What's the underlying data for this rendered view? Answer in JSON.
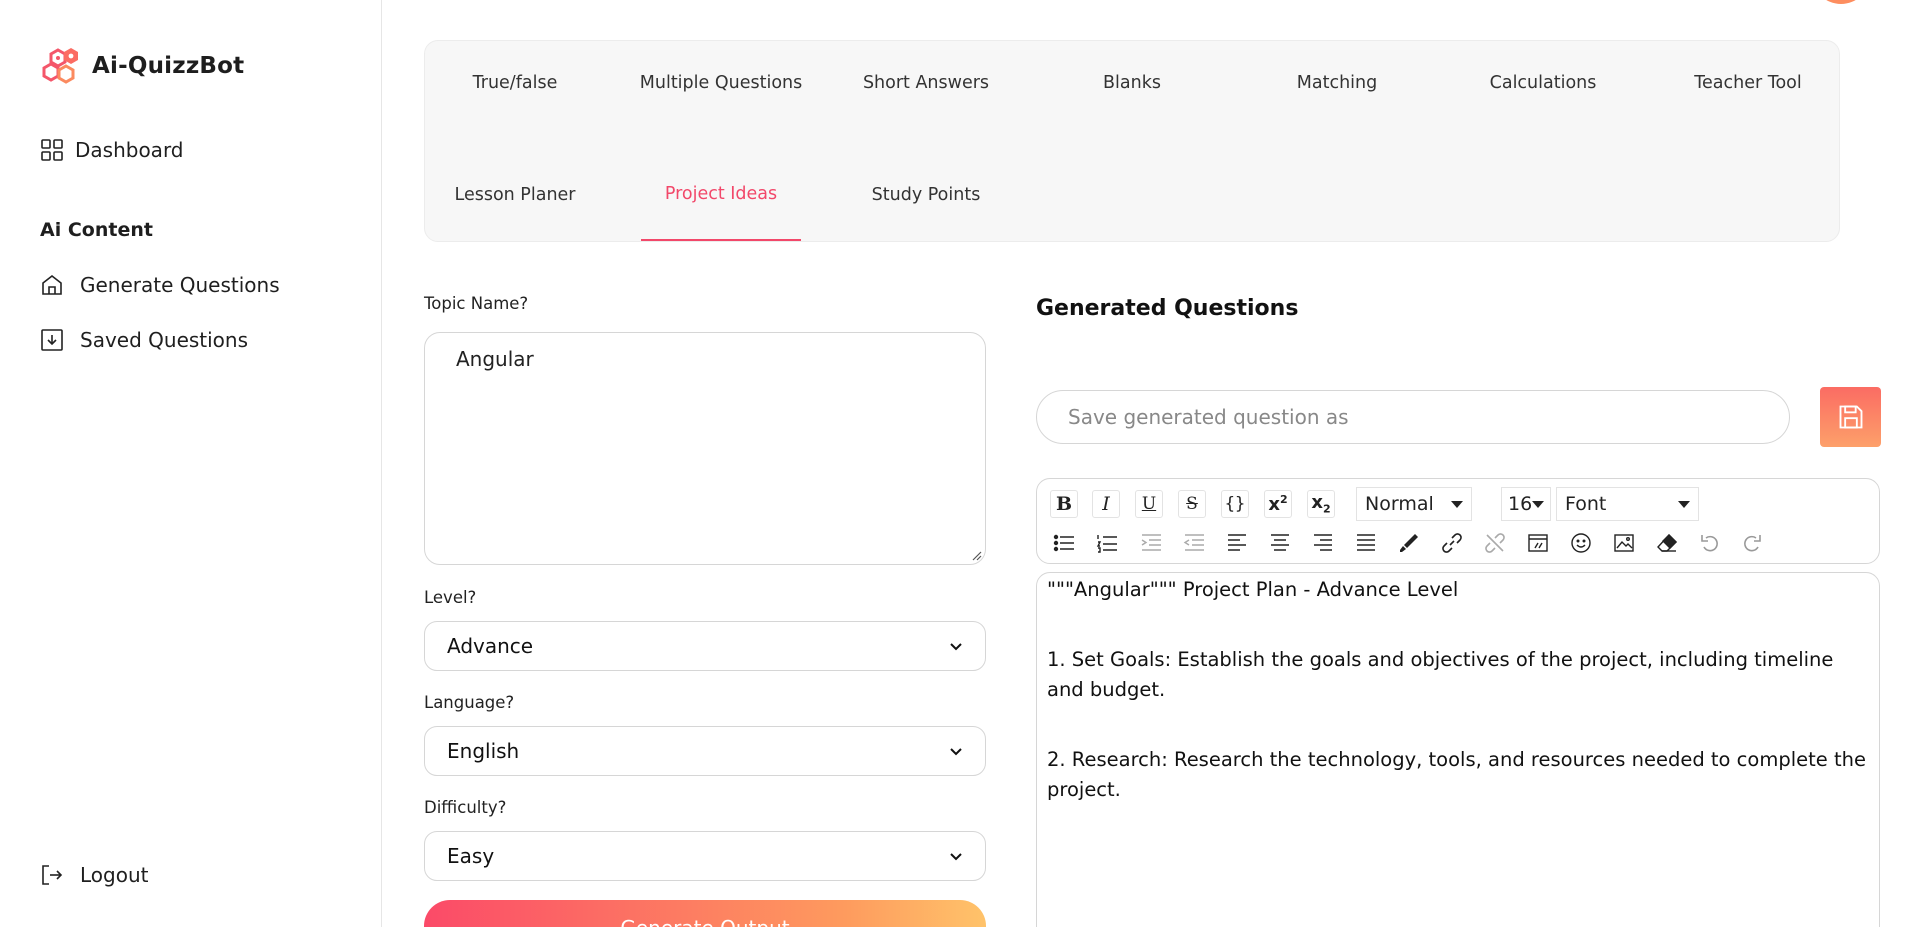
{
  "app": {
    "name": "Ai-QuizzBot"
  },
  "sidebar": {
    "dashboard": "Dashboard",
    "section_title": "Ai Content",
    "generate_questions": "Generate Questions",
    "saved_questions": "Saved Questions",
    "logout": "Logout"
  },
  "tabs": [
    {
      "label": "True/false"
    },
    {
      "label": "Multiple Questions"
    },
    {
      "label": "Short Answers"
    },
    {
      "label": "Blanks"
    },
    {
      "label": "Matching"
    },
    {
      "label": "Calculations"
    },
    {
      "label": "Teacher Tool"
    },
    {
      "label": "Lesson Planer"
    },
    {
      "label": "Project Ideas"
    },
    {
      "label": "Study Points"
    }
  ],
  "active_tab": "Project Ideas",
  "form": {
    "topic_label": "Topic Name?",
    "topic_value": "Angular",
    "level_label": "Level?",
    "level_value": "Advance",
    "language_label": "Language?",
    "language_value": "English",
    "difficulty_label": "Difficulty?",
    "difficulty_value": "Easy",
    "generate_button": "Generate Output"
  },
  "output": {
    "title": "Generated Questions",
    "save_placeholder": "Save generated question as",
    "toolbar": {
      "header_value": "Normal",
      "size_value": "16",
      "font_value": "Font"
    },
    "editor": {
      "line1": "\"\"\"Angular\"\"\" Project Plan - Advance Level",
      "line2": "1. Set Goals: Establish the goals and objectives of the project, including timeline and budget.",
      "line3": "2. Research: Research the technology, tools, and resources needed to complete the project."
    }
  },
  "colors": {
    "accent": "#f2486a",
    "gradient_start": "#fb4a68",
    "gradient_end": "#ffc36a"
  }
}
